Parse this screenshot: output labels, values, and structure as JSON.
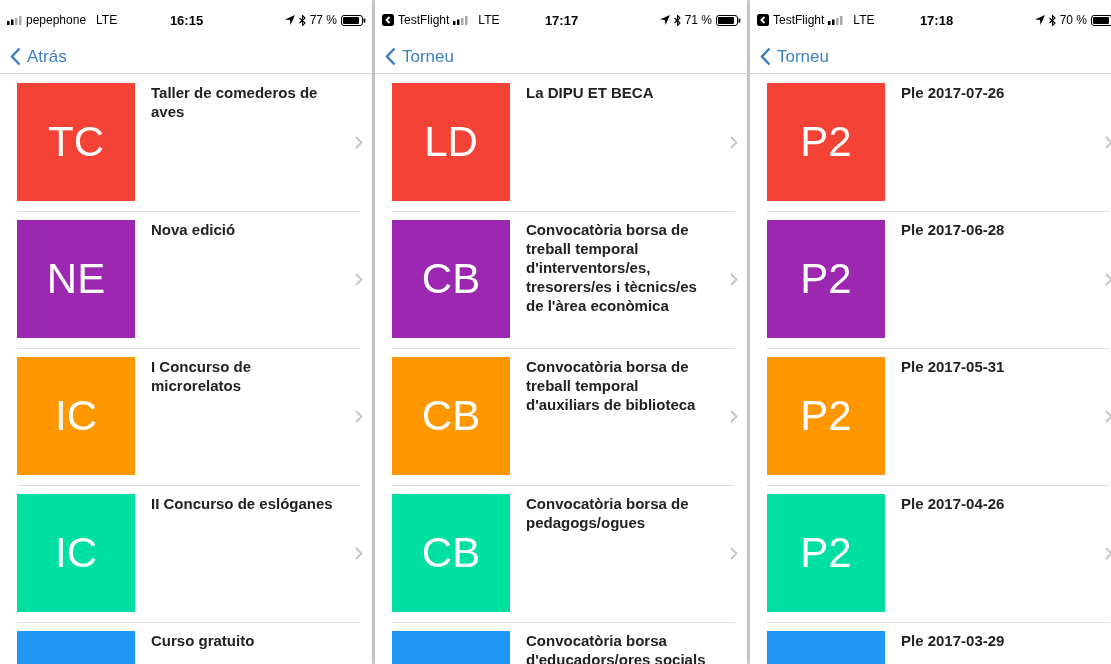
{
  "screens": [
    {
      "status_bar": {
        "carrier": "pepephone",
        "network": "LTE",
        "time": "16:15",
        "battery": "77 %"
      },
      "back_button": "Atrás",
      "items": [
        {
          "initials": "TC",
          "title": "Taller de comederos de aves",
          "color": "#f44336"
        },
        {
          "initials": "NE",
          "title": "Nova edició",
          "color": "#9c27b0"
        },
        {
          "initials": "IC",
          "title": "I Concurso de microrelatos",
          "color": "#ff9800"
        },
        {
          "initials": "IC",
          "title": "II Concurso de eslóganes",
          "color": "#00dfa2"
        },
        {
          "title": "Curso gratuito",
          "color": "#2196f3"
        }
      ]
    },
    {
      "status_bar": {
        "return_app": "TestFlight",
        "network": "LTE",
        "time": "17:17",
        "battery": "71 %"
      },
      "back_button": "Torneu",
      "items": [
        {
          "initials": "LD",
          "title": "La DIPU ET BECA",
          "color": "#f44336"
        },
        {
          "initials": "CB",
          "title": "Convocatòria borsa de treball temporal d'interventors/es, tresorers/es i tècnics/es de l'àrea econòmica",
          "color": "#9c27b0"
        },
        {
          "initials": "CB",
          "title": "Convocatòria borsa de treball temporal d'auxiliars de biblioteca",
          "color": "#ff9800"
        },
        {
          "initials": "CB",
          "title": "Convocatòria borsa de pedagogs/ogues",
          "color": "#00dfa2"
        },
        {
          "title": "Convocatòria borsa d'educadors/ores socials",
          "color": "#2196f3"
        }
      ]
    },
    {
      "status_bar": {
        "return_app": "TestFlight",
        "network": "LTE",
        "time": "17:18",
        "battery": "70 %"
      },
      "back_button": "Torneu",
      "items": [
        {
          "initials": "P2",
          "title": "Ple 2017-07-26",
          "color": "#f44336"
        },
        {
          "initials": "P2",
          "title": "Ple 2017-06-28",
          "color": "#9c27b0"
        },
        {
          "initials": "P2",
          "title": "Ple 2017-05-31",
          "color": "#ff9800"
        },
        {
          "initials": "P2",
          "title": "Ple 2017-04-26",
          "color": "#00dfa2"
        },
        {
          "title": "Ple 2017-03-29",
          "color": "#2196f3"
        }
      ]
    }
  ]
}
